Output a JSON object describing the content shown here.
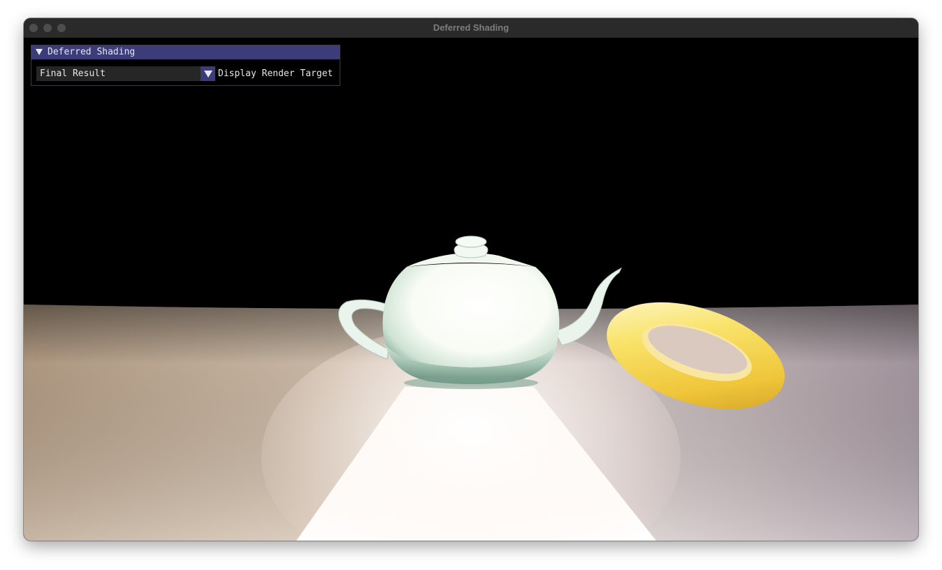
{
  "window": {
    "title": "Deferred Shading"
  },
  "panel": {
    "header": "Deferred Shading",
    "combo": {
      "selected": "Final Result",
      "label": "Display Render Target"
    }
  },
  "scene": {
    "objects": [
      "teapot",
      "torus",
      "floor-plane"
    ],
    "colors": {
      "background": "#000000",
      "teapot": "#f5fbf5",
      "torus": "#f7d94a",
      "floor_warm": "#c7ad8f",
      "floor_cool": "#b9a8b3"
    }
  }
}
